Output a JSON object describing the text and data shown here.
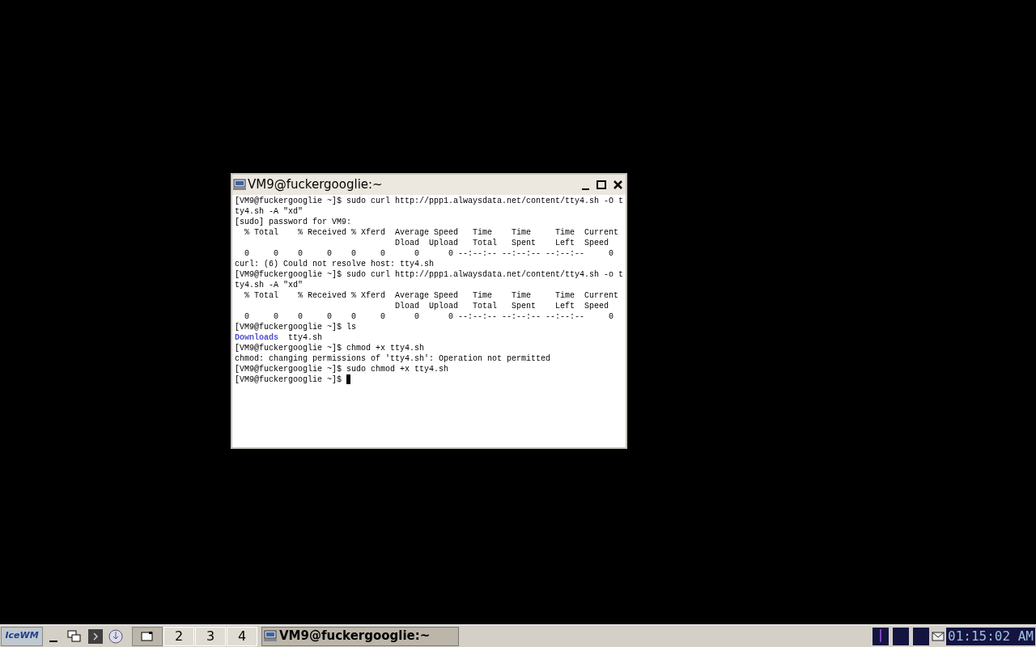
{
  "window": {
    "title": "VM9@fuckergooglie:~",
    "focused": true
  },
  "terminal": {
    "lines": [
      {
        "parts": [
          {
            "text": "[VM9@fuckergooglie ~]$ sudo curl http://ppp1.alwaysdata.net/content/tty4.sh -O t",
            "kind": "plain"
          }
        ]
      },
      {
        "parts": [
          {
            "text": "ty4.sh -A \"xd\"",
            "kind": "plain"
          }
        ]
      },
      {
        "parts": [
          {
            "text": "[sudo] password for VM9:",
            "kind": "plain"
          }
        ]
      },
      {
        "parts": [
          {
            "text": "  % Total    % Received % Xferd  Average Speed   Time    Time     Time  Current",
            "kind": "plain"
          }
        ]
      },
      {
        "parts": [
          {
            "text": "                                 Dload  Upload   Total   Spent    Left  Speed",
            "kind": "plain"
          }
        ]
      },
      {
        "parts": [
          {
            "text": "  0     0    0     0    0     0      0      0 --:--:-- --:--:-- --:--:--     0",
            "kind": "plain"
          }
        ]
      },
      {
        "parts": [
          {
            "text": "curl: (6) Could not resolve host: tty4.sh",
            "kind": "plain"
          }
        ]
      },
      {
        "parts": [
          {
            "text": "[VM9@fuckergooglie ~]$ sudo curl http://ppp1.alwaysdata.net/content/tty4.sh -o t",
            "kind": "plain"
          }
        ]
      },
      {
        "parts": [
          {
            "text": "ty4.sh -A \"xd\"",
            "kind": "plain"
          }
        ]
      },
      {
        "parts": [
          {
            "text": "  % Total    % Received % Xferd  Average Speed   Time    Time     Time  Current",
            "kind": "plain"
          }
        ]
      },
      {
        "parts": [
          {
            "text": "                                 Dload  Upload   Total   Spent    Left  Speed",
            "kind": "plain"
          }
        ]
      },
      {
        "parts": [
          {
            "text": "  0     0    0     0    0     0      0      0 --:--:-- --:--:-- --:--:--     0",
            "kind": "plain"
          }
        ]
      },
      {
        "parts": [
          {
            "text": "[VM9@fuckergooglie ~]$ ls",
            "kind": "plain"
          }
        ]
      },
      {
        "parts": [
          {
            "text": "Downloads",
            "kind": "directory"
          },
          {
            "text": "  tty4.sh",
            "kind": "plain"
          }
        ]
      },
      {
        "parts": [
          {
            "text": "[VM9@fuckergooglie ~]$ chmod +x tty4.sh",
            "kind": "plain"
          }
        ]
      },
      {
        "parts": [
          {
            "text": "chmod: changing permissions of 'tty4.sh': Operation not permitted",
            "kind": "plain"
          }
        ]
      },
      {
        "parts": [
          {
            "text": "[VM9@fuckergooglie ~]$ sudo chmod +x tty4.sh",
            "kind": "plain"
          }
        ]
      },
      {
        "parts": [
          {
            "text": "[VM9@fuckergooglie ~]$ ",
            "kind": "plain"
          }
        ],
        "cursor": true
      }
    ]
  },
  "taskbar": {
    "start_label": "IceWM",
    "workspaces": [
      {
        "selected": true
      },
      {
        "label": "2",
        "selected": false
      },
      {
        "label": "3",
        "selected": false
      },
      {
        "label": "4",
        "selected": false
      }
    ],
    "tasks": [
      {
        "label": "VM9@fuckergooglie:~",
        "selected": true
      }
    ],
    "clock": "01:15:02 AM"
  }
}
